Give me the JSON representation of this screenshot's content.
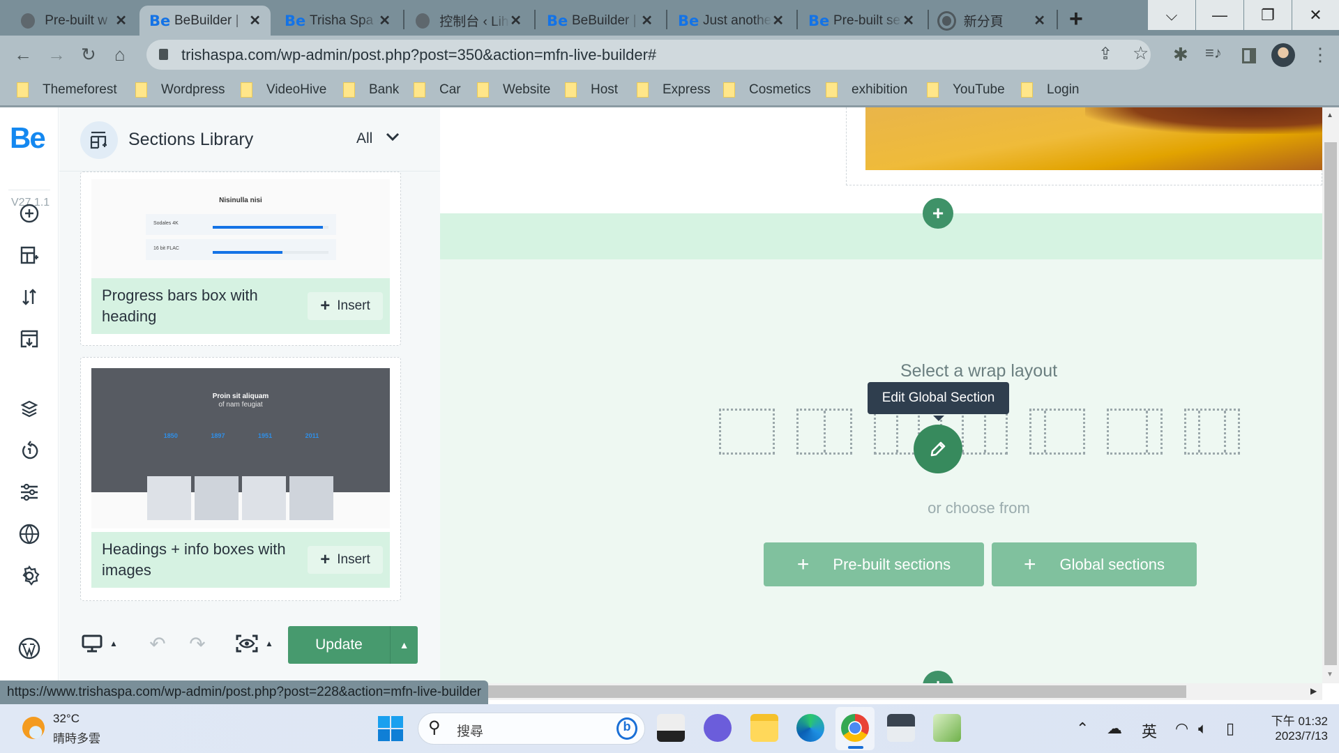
{
  "browser": {
    "tabs": [
      {
        "label": "Pre-built w",
        "icon": "globe-icon",
        "active": false
      },
      {
        "label": "BeBuilder |",
        "icon": "be-icon",
        "active": true
      },
      {
        "label": "Trisha Spa -",
        "icon": "be-icon",
        "active": false
      },
      {
        "label": "控制台 ‹ Lih",
        "icon": "globe-icon",
        "active": false
      },
      {
        "label": "BeBuilder |",
        "icon": "be-icon",
        "active": false
      },
      {
        "label": "Just anothe",
        "icon": "be-icon",
        "active": false
      },
      {
        "label": "Pre-built se",
        "icon": "be-icon",
        "active": false
      },
      {
        "label": "新分頁",
        "icon": "chrome-icon",
        "active": false
      }
    ],
    "tab_icon_text": "Be",
    "close_glyph": "✕",
    "new_tab_glyph": "+",
    "window_controls": {
      "tab_search": "⌵",
      "minimize": "—",
      "restore": "❐",
      "close": "✕"
    },
    "url": "trishaspa.com/wp-admin/post.php?post=350&action=mfn-live-builder#",
    "bookmarks": [
      "Themeforest",
      "Wordpress",
      "VideoHive",
      "Bank",
      "Car",
      "Website",
      "Host",
      "Express",
      "Cosmetics",
      "exhibition",
      "YouTube",
      "Login"
    ],
    "status_url": "https://www.trishaspa.com/wp-admin/post.php?post=228&action=mfn-live-builder"
  },
  "builder": {
    "logo": "Be",
    "version": "V27.1.1",
    "sidebar_icons": [
      "add-element-icon",
      "add-section-icon",
      "sort-icon",
      "templates-icon",
      "layers-icon",
      "history-icon",
      "settings-sliders-icon",
      "globe-icon",
      "gear-icon",
      "wordpress-icon"
    ],
    "panel": {
      "title": "Sections Library",
      "filter": "All",
      "cards": [
        {
          "name": "Progress bars box with heading",
          "insert_label": "Insert",
          "preview": {
            "heading": "Nisinulla nisi",
            "bars": [
              {
                "label": "Sodales 4K",
                "progress": 0.95
              },
              {
                "label": "16 bit FLAC",
                "progress": 0.6
              }
            ]
          }
        },
        {
          "name": "Headings + info boxes with images",
          "insert_label": "Insert",
          "preview": {
            "heading_line1": "Proin sit aliquam",
            "heading_line2": "of nam feugiat",
            "years": [
              "1850",
              "1897",
              "1951",
              "2011"
            ]
          }
        }
      ]
    },
    "bottom_bar": {
      "update_label": "Update"
    },
    "canvas": {
      "select_layout_text": "Select a wrap layout",
      "tooltip": "Edit Global Section",
      "or_choose_text": "or choose from",
      "buttons": [
        {
          "label": "Pre-built sections"
        },
        {
          "label": "Global sections"
        }
      ],
      "layouts": [
        [
          1
        ],
        [
          1,
          1
        ],
        [
          1,
          1,
          1,
          1,
          1,
          1
        ],
        [
          1,
          3
        ],
        [
          3,
          1
        ],
        [
          1,
          2,
          1
        ]
      ]
    },
    "colors": {
      "accent_green": "#479a6e",
      "brand_blue": "#1488f0",
      "light_green": "#d6f2e2"
    }
  },
  "taskbar": {
    "weather_temp": "32°C",
    "weather_desc": "晴時多雲",
    "search_placeholder": "搜尋",
    "ime": "英",
    "time": "下午 01:32",
    "date": "2023/7/13"
  }
}
